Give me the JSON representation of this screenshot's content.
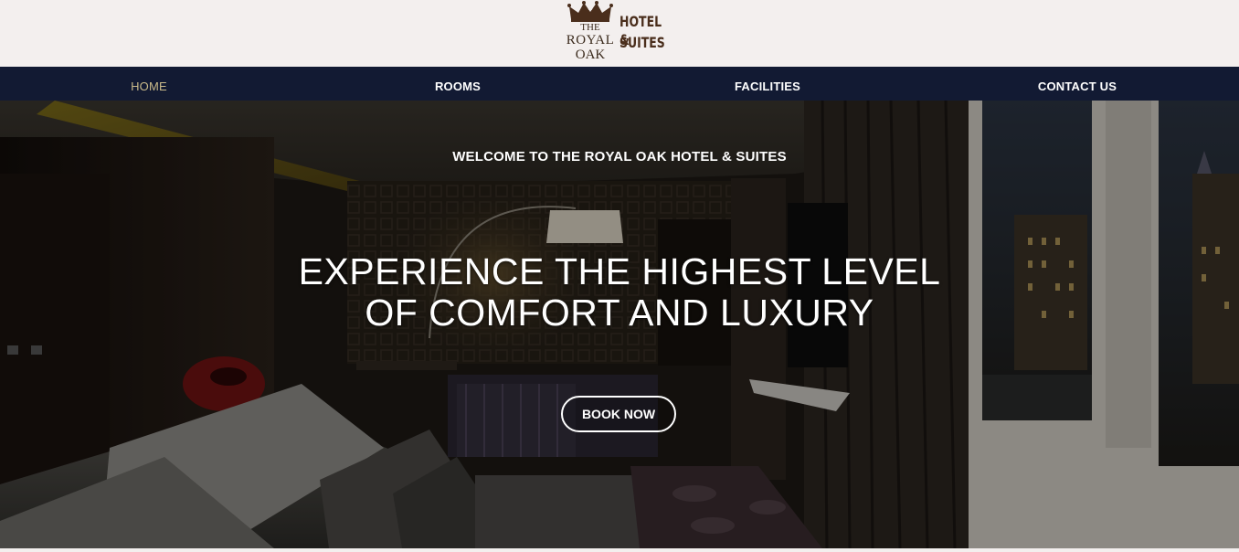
{
  "brand": {
    "the": "THE",
    "royal": "ROYAL",
    "oak": "OAK",
    "hotel": "HOTEL &",
    "suites": "SUITES",
    "icon": "crown-icon",
    "color": "#4a2e1c"
  },
  "nav": {
    "items": [
      {
        "label": "HOME",
        "active": true
      },
      {
        "label": "ROOMS",
        "active": false
      },
      {
        "label": "FACILITIES",
        "active": false
      },
      {
        "label": "CONTACT US",
        "active": false
      }
    ],
    "background": "#121a33",
    "active_color": "#c8b98a"
  },
  "hero": {
    "welcome": "WELCOME TO THE ROYAL OAK HOTEL & SUITES",
    "headline_line1": "EXPERIENCE THE HIGHEST LEVEL",
    "headline_line2": "OF COMFORT AND LUXURY",
    "cta_label": "BOOK NOW"
  }
}
